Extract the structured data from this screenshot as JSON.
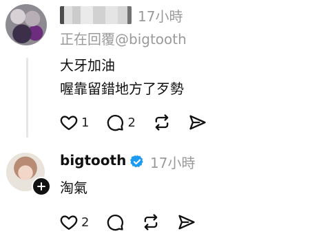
{
  "post1": {
    "time": "17小時",
    "replying_to": "正在回覆@bigtooth",
    "lines": [
      "大牙加油",
      "喔靠留錯地方了歹勢"
    ],
    "actions": {
      "likes": "1",
      "comments": "2"
    }
  },
  "post2": {
    "username": "bigtooth",
    "time": "17小時",
    "text": "淘氣",
    "actions": {
      "likes": "2"
    }
  },
  "icons": {
    "like": "heart-icon",
    "comment": "comment-icon",
    "repost": "repost-icon",
    "share": "send-icon",
    "verified": "verified-badge-icon",
    "follow": "plus-icon"
  },
  "colors": {
    "verified_blue": "#1d9bf0",
    "muted_text": "#9a9a9a",
    "thread_line": "#e6e6e6"
  }
}
